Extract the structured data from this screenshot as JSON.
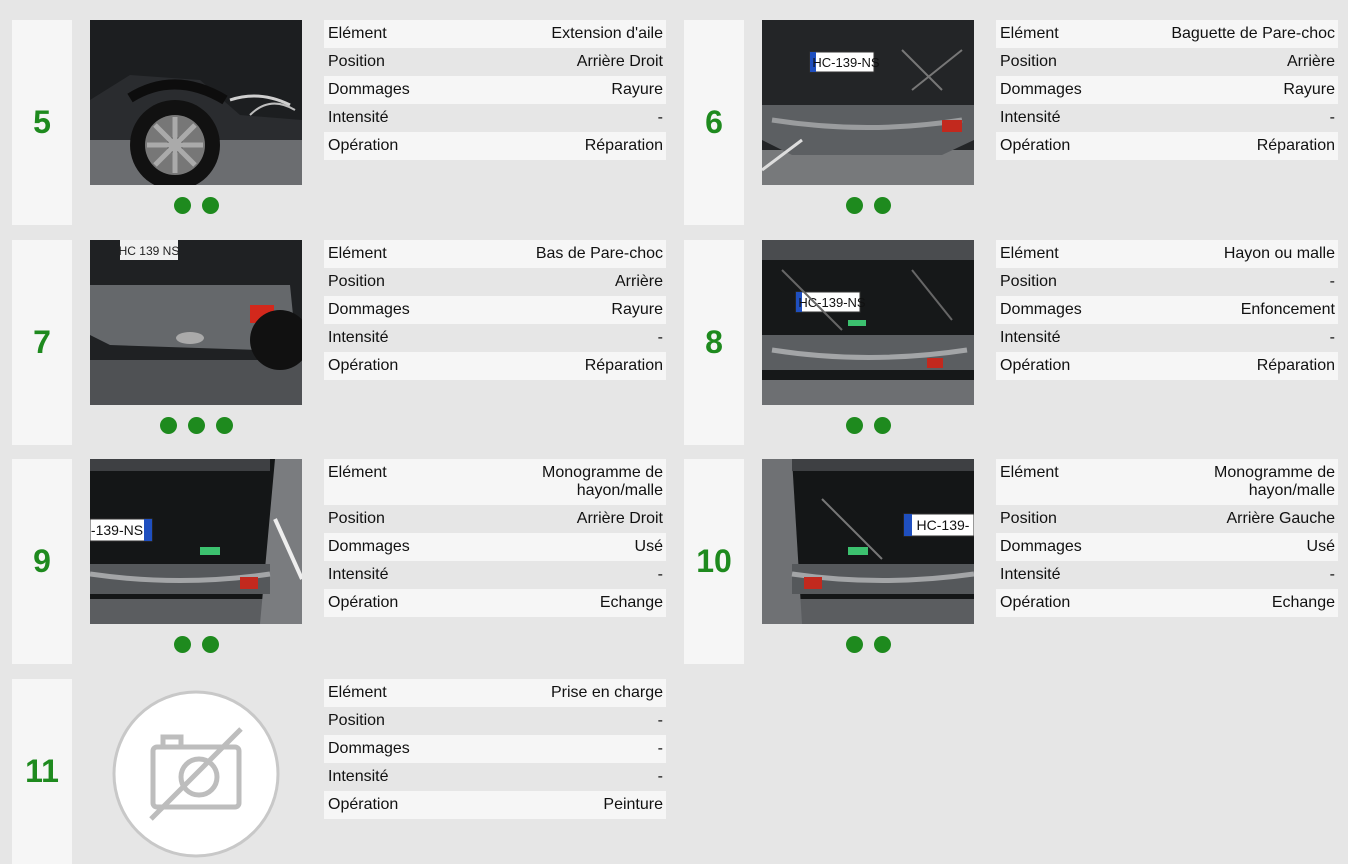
{
  "labels": {
    "element": "Elément",
    "position": "Position",
    "dommages": "Dommages",
    "intensite": "Intensité",
    "operation": "Opération"
  },
  "colors": {
    "accent": "#1e8a1e",
    "panel": "#f6f6f6",
    "background": "#e6e6e6"
  },
  "cards": [
    {
      "number": "5",
      "dots": 2,
      "photo": "side-wheel",
      "element": "Extension d'aile",
      "position": "Arrière Droit",
      "dommages": "Rayure",
      "intensite": "-",
      "operation": "Réparation"
    },
    {
      "number": "6",
      "dots": 2,
      "photo": "rear-plate",
      "element": "Baguette de Pare-choc",
      "position": "Arrière",
      "dommages": "Rayure",
      "intensite": "-",
      "operation": "Réparation"
    },
    {
      "number": "7",
      "dots": 3,
      "photo": "rear-bumper",
      "element": "Bas de Pare-choc",
      "position": "Arrière",
      "dommages": "Rayure",
      "intensite": "-",
      "operation": "Réparation"
    },
    {
      "number": "8",
      "dots": 2,
      "photo": "tailgate",
      "element": "Hayon ou malle",
      "position": "-",
      "dommages": "Enfoncement",
      "intensite": "-",
      "operation": "Réparation"
    },
    {
      "number": "9",
      "dots": 2,
      "photo": "rear-right",
      "element": "Monogramme de hayon/malle",
      "position": "Arrière Droit",
      "dommages": "Usé",
      "intensite": "-",
      "operation": "Echange"
    },
    {
      "number": "10",
      "dots": 2,
      "photo": "rear-left",
      "element": "Monogramme de hayon/malle",
      "position": "Arrière Gauche",
      "dommages": "Usé",
      "intensite": "-",
      "operation": "Echange"
    },
    {
      "number": "11",
      "dots": 0,
      "photo": "no-photo-icon",
      "element": "Prise en charge",
      "position": "-",
      "dommages": "-",
      "intensite": "-",
      "operation": "Peinture"
    }
  ],
  "plates": {
    "full": "HC-139-NS",
    "partial_left": "-139-NS",
    "partial_right": "HC-139-",
    "partial_top": "HC 139 NS"
  }
}
